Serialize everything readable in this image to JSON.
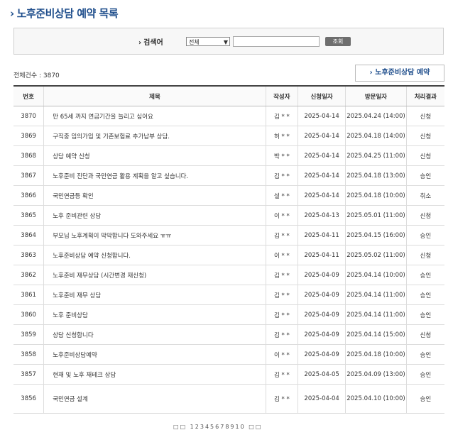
{
  "page": {
    "title": "노후준비상담 예약 목록"
  },
  "search": {
    "label": "검색어",
    "select_value": "전체",
    "input_value": "",
    "button_label": "조회"
  },
  "summary": {
    "total_text": "전체건수 : 3870"
  },
  "actions": {
    "reserve_label": "노후준비상담 예약"
  },
  "table": {
    "headers": [
      "번호",
      "제목",
      "작성자",
      "신청일자",
      "방문일자",
      "처리결과"
    ],
    "rows": [
      {
        "no": "3870",
        "title": "만 65세 까지 연금기간을 늘리고 싶어요",
        "writer": "김 * *",
        "applied": "2025-04-14",
        "visit": "2025.04.24 (14:00)",
        "status": "신청"
      },
      {
        "no": "3869",
        "title": "구직중 임의가입 및 기존보험료 추가납부 상담.",
        "writer": "허 * *",
        "applied": "2025-04-14",
        "visit": "2025.04.18 (14:00)",
        "status": "신청"
      },
      {
        "no": "3868",
        "title": "상담 예약 신청",
        "writer": "박 * *",
        "applied": "2025-04-14",
        "visit": "2025.04.25 (11:00)",
        "status": "신청"
      },
      {
        "no": "3867",
        "title": "노후준비 진단과 국민연금 활용 계획을 알고 싶습니다.",
        "writer": "김 * *",
        "applied": "2025-04-14",
        "visit": "2025.04.18 (13:00)",
        "status": "승인"
      },
      {
        "no": "3866",
        "title": "국민연금등 확인",
        "writer": "설 * *",
        "applied": "2025-04-14",
        "visit": "2025.04.18 (10:00)",
        "status": "취소"
      },
      {
        "no": "3865",
        "title": "노후 준비관련 상담",
        "writer": "이 * *",
        "applied": "2025-04-13",
        "visit": "2025.05.01 (11:00)",
        "status": "신청"
      },
      {
        "no": "3864",
        "title": "부모님 노후계획이 막막합니다 도와주세요 ㅠㅠ",
        "writer": "김 * *",
        "applied": "2025-04-11",
        "visit": "2025.04.15 (16:00)",
        "status": "승인"
      },
      {
        "no": "3863",
        "title": "노후준비상담 예약 신청합니다.",
        "writer": "이 * *",
        "applied": "2025-04-11",
        "visit": "2025.05.02 (11:00)",
        "status": "신청"
      },
      {
        "no": "3862",
        "title": "노후준비 재무상담 (시간변경 재신청)",
        "writer": "김 * *",
        "applied": "2025-04-09",
        "visit": "2025.04.14 (10:00)",
        "status": "승인"
      },
      {
        "no": "3861",
        "title": "노후준비 재무 상담",
        "writer": "김 * *",
        "applied": "2025-04-09",
        "visit": "2025.04.14 (11:00)",
        "status": "승인"
      },
      {
        "no": "3860",
        "title": "노후 준비상담",
        "writer": "김 * *",
        "applied": "2025-04-09",
        "visit": "2025.04.14 (11:00)",
        "status": "승인"
      },
      {
        "no": "3859",
        "title": "상담 신청합니다",
        "writer": "김 * *",
        "applied": "2025-04-09",
        "visit": "2025.04.14 (15:00)",
        "status": "신청"
      },
      {
        "no": "3858",
        "title": "노후준비상담예약",
        "writer": "이 * *",
        "applied": "2025-04-09",
        "visit": "2025.04.18 (10:00)",
        "status": "승인"
      },
      {
        "no": "3857",
        "title": "현재 및 노후 재테크 상담",
        "writer": "김 * *",
        "applied": "2025-04-05",
        "visit": "2025.04.09 (13:00)",
        "status": "승인"
      },
      {
        "no": "3856",
        "title": "국민연금 설계",
        "writer": "김 * *",
        "applied": "2025-04-04",
        "visit": "2025.04.10 (10:00)",
        "status": "승인"
      }
    ]
  },
  "pagination": {
    "pages": [
      "1",
      "2",
      "3",
      "4",
      "5",
      "6",
      "7",
      "8",
      "9",
      "10"
    ]
  }
}
